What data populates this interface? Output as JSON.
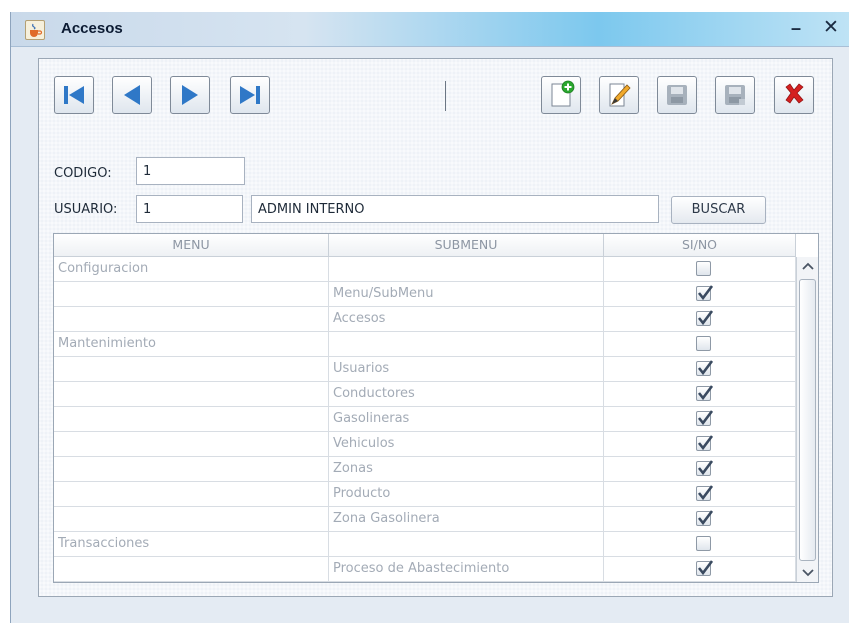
{
  "window": {
    "title": "Accesos",
    "minimize_glyph": "–",
    "close_glyph": "✕",
    "app_icon": "java-cup-icon"
  },
  "toolbar": {
    "nav_buttons": [
      "first-record-icon",
      "previous-record-icon",
      "next-record-icon",
      "last-record-icon"
    ],
    "action_buttons": [
      "new-document-icon",
      "edit-pencil-icon",
      "save-disk-icon",
      "save-as-disk-icon",
      "delete-x-icon"
    ],
    "colors": {
      "nav_arrow": "#2f78c7",
      "new_plus": "#2aa72e",
      "delete": "#d42020",
      "disabled": "#9aa6b3"
    }
  },
  "form": {
    "codigo_label": "CODIGO:",
    "codigo_value": "1",
    "usuario_label": "USUARIO:",
    "usuario_value": "1",
    "usuario_name": "ADMIN INTERNO",
    "buscar_label": "BUSCAR"
  },
  "table": {
    "columns": [
      "MENU",
      "SUBMENU",
      "SI/NO"
    ],
    "rows": [
      {
        "menu": "Configuracion",
        "submenu": "",
        "checked": false
      },
      {
        "menu": "",
        "submenu": "Menu/SubMenu",
        "checked": true
      },
      {
        "menu": "",
        "submenu": "Accesos",
        "checked": true
      },
      {
        "menu": "Mantenimiento",
        "submenu": "",
        "checked": false
      },
      {
        "menu": "",
        "submenu": "Usuarios",
        "checked": true
      },
      {
        "menu": "",
        "submenu": "Conductores",
        "checked": true
      },
      {
        "menu": "",
        "submenu": "Gasolineras",
        "checked": true
      },
      {
        "menu": "",
        "submenu": "Vehiculos",
        "checked": true
      },
      {
        "menu": "",
        "submenu": "Zonas",
        "checked": true
      },
      {
        "menu": "",
        "submenu": "Producto",
        "checked": true
      },
      {
        "menu": "",
        "submenu": "Zona Gasolinera",
        "checked": true
      },
      {
        "menu": "Transacciones",
        "submenu": "",
        "checked": false
      },
      {
        "menu": "",
        "submenu": "Proceso de Abastecimiento",
        "checked": true
      },
      {
        "menu": "",
        "submenu": "",
        "checked": true
      }
    ]
  }
}
